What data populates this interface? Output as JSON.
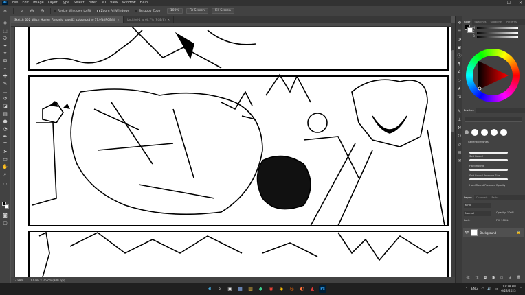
{
  "app": {
    "logo": "Ps"
  },
  "menu": [
    "File",
    "Edit",
    "Image",
    "Layer",
    "Type",
    "Select",
    "Filter",
    "3D",
    "View",
    "Window",
    "Help"
  ],
  "window_controls": [
    "—",
    "☐",
    "✕"
  ],
  "options": {
    "resize_windows": "Resize Windows to Fit",
    "zoom_all": "Zoom All Windows",
    "scrubby_zoom": "Scrubby Zoom",
    "btn_100": "100%",
    "btn_fit": "Fit Screen",
    "btn_fill": "Fill Screen"
  },
  "tabs": [
    {
      "label": "Sketch_002_Witch_Hunter_Fanomic_page02_colour.psd @ 17.9% (RGB/8)",
      "active": true
    },
    {
      "label": "Untitled-1 @ 66.7% (RGB/8)",
      "active": false
    }
  ],
  "status": {
    "zoom": "17.88%",
    "doc": "17 cm × 26 cm (300 ppi)"
  },
  "color_panel": {
    "tabs": [
      "Color",
      "Swatches",
      "Gradients",
      "Patterns"
    ]
  },
  "brushes_panel": {
    "title": "Brushes",
    "group": "General Brushes",
    "brushes": [
      "Soft Round",
      "Hard Round",
      "Soft Round Pressure Size",
      "Hard Round Pressure Opacity"
    ]
  },
  "layers_panel": {
    "tabs": [
      "Layers",
      "Channels",
      "Paths"
    ],
    "kind": "Kind",
    "mode": "Normal",
    "opacity": "Opacity: 100%",
    "lock": "Lock:",
    "fill": "Fill: 100%",
    "layers": [
      {
        "name": "Background"
      }
    ]
  },
  "taskbar": {
    "icons": [
      "⊞",
      "⌕",
      "▣",
      "▦",
      "▥",
      "◆",
      "◉",
      "◈",
      "◎",
      "◐",
      "▲",
      "Ps"
    ]
  },
  "tray": {
    "lang": "ENG",
    "time": "12:28 PM",
    "date": "6/28/2023"
  }
}
